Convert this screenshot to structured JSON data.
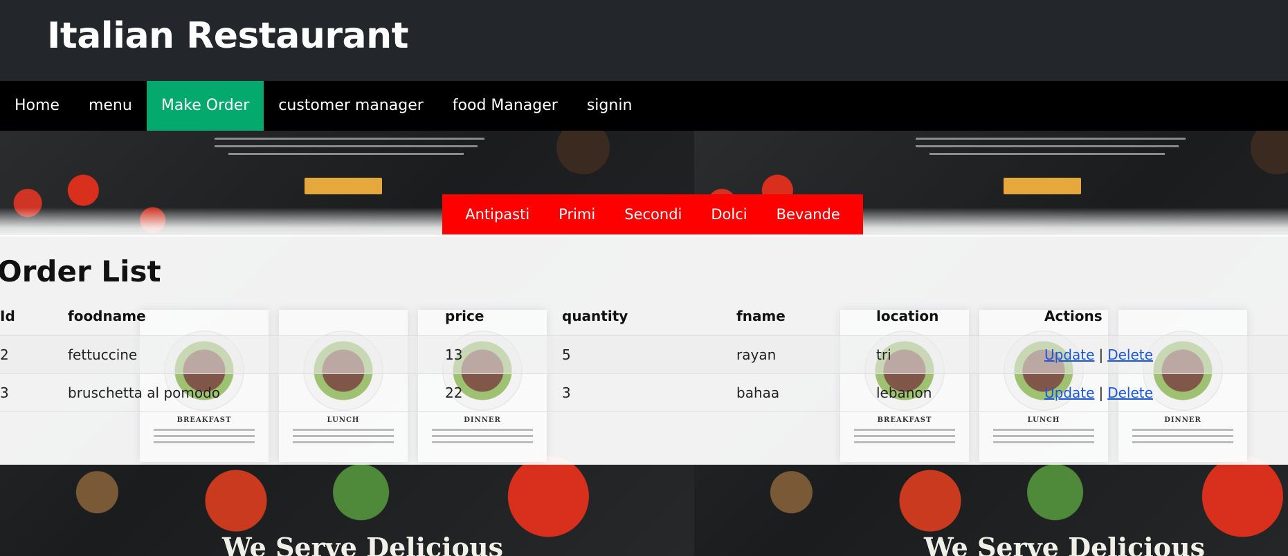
{
  "header": {
    "title": "Italian Restaurant"
  },
  "nav": {
    "items": [
      {
        "label": "Home"
      },
      {
        "label": "menu"
      },
      {
        "label": "Make Order",
        "active": true
      },
      {
        "label": "customer manager"
      },
      {
        "label": "food Manager"
      },
      {
        "label": "signin"
      }
    ],
    "active_color": "#04aa6d"
  },
  "categories": {
    "items": [
      {
        "label": "Antipasti"
      },
      {
        "label": "Primi"
      },
      {
        "label": "Secondi"
      },
      {
        "label": "Dolci"
      },
      {
        "label": "Bevande"
      }
    ],
    "color": "#ff0000"
  },
  "background": {
    "headline": "We Serve Delicious",
    "cards": [
      "BREAKFAST",
      "LUNCH",
      "DINNER",
      "BREAKFAST",
      "LUNCH",
      "DINNER"
    ]
  },
  "order_list": {
    "title": "Order List",
    "columns": [
      "Id",
      "foodname",
      "price",
      "quantity",
      "fname",
      "location",
      "Actions"
    ],
    "rows": [
      {
        "id": "2",
        "foodname": "fettuccine",
        "price": "13",
        "quantity": "5",
        "fname": "rayan",
        "location": "tri",
        "update": "Update",
        "separator": "|",
        "delete": "Delete"
      },
      {
        "id": "3",
        "foodname": "bruschetta al pomodo",
        "price": "22",
        "quantity": "3",
        "fname": "bahaa",
        "location": "lebanon",
        "update": "Update",
        "separator": "|",
        "delete": "Delete"
      }
    ]
  }
}
